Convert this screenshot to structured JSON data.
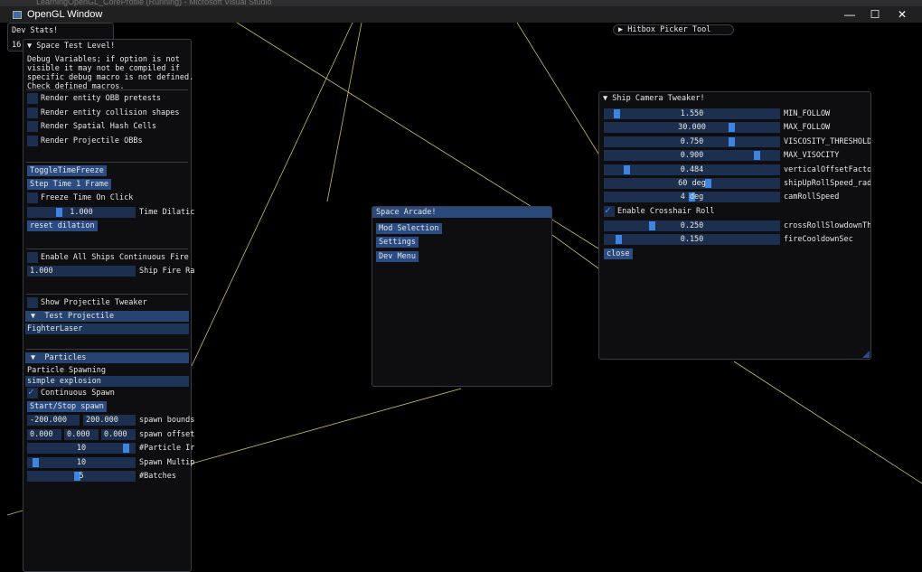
{
  "vs_title": "LearningOpenGL_CoreProfile (Running) - Microsoft Visual Studio",
  "window_title": "OpenGL Window",
  "window_controls": {
    "minimize": "—",
    "maximize": "☐",
    "close": "✕"
  },
  "dev_stats": {
    "title": "Dev Stats!",
    "value": "16."
  },
  "hitbox_picker": {
    "title": "Hitbox Picker Tool"
  },
  "space_test": {
    "title": "Space Test Level!",
    "note": [
      "Debug Variables; if option is not",
      "visible it may not be compiled if",
      "specific debug macro is not defined.",
      "Check defined macros."
    ],
    "render_options": [
      {
        "label": "Render entity OBB pretests",
        "checked": false
      },
      {
        "label": "Render entity collision shapes",
        "checked": false
      },
      {
        "label": "Render Spatial Hash Cells",
        "checked": false
      },
      {
        "label": "Render Projectile OBBs",
        "checked": false
      }
    ],
    "toggle_time_freeze": "ToggleTimeFreeze",
    "step_time": "Step Time 1 Frame",
    "freeze_on_click": "Freeze Time On Click",
    "time_dilation": {
      "value": "1.000",
      "label": "Time Dilatic",
      "fraction": 0.27
    },
    "reset_dilation": "reset dilation",
    "continuous_fire": "Enable All Ships Continuous Fire",
    "ship_fire_rate": {
      "value": "1.000",
      "label": "Ship Fire Ra"
    },
    "show_projectile_tweaker": "Show Projectile Tweaker",
    "test_projectile_header": "Test Projectile",
    "projectile_selected": "FighterLaser",
    "particles_header": "Particles",
    "particle_spawning_label": "Particle Spawning",
    "particle_selected": "simple explosion",
    "continuous_spawn": "Continuous Spawn",
    "start_stop_spawn": "Start/Stop spawn",
    "spawn_bounds": {
      "values": [
        "-200.000",
        "200.000"
      ],
      "label": "spawn bounds"
    },
    "spawn_offset": {
      "values": [
        "0.000",
        "0.000",
        "0.000"
      ],
      "label": "spawn offset"
    },
    "particle_interval": {
      "value": "10",
      "label": "#Particle Ir",
      "fraction": 0.95
    },
    "spawn_multiplier": {
      "value": "10",
      "label": "Spawn Multip",
      "fraction": 0.04
    },
    "batches": {
      "value": "5",
      "label": "#Batches",
      "fraction": 0.46
    }
  },
  "space_arcade": {
    "title": "Space Arcade!",
    "buttons": [
      "Mod Selection",
      "Settings",
      "Dev Menu"
    ]
  },
  "camera_tweaker": {
    "title": "Ship Camera Tweaker!",
    "sliders": [
      {
        "value": "1.550",
        "label": "MIN_FOLLOW",
        "fraction": 0.05
      },
      {
        "value": "30.000",
        "label": "MAX_FOLLOW",
        "fraction": 0.74
      },
      {
        "value": "0.750",
        "label": "VISCOSITY_THRESHOLD",
        "fraction": 0.74
      },
      {
        "value": "0.900",
        "label": "MAX_VISOCITY",
        "fraction": 0.89
      },
      {
        "value": "0.484",
        "label": "verticalOffsetFactor",
        "fraction": 0.11
      },
      {
        "value": "60 deg",
        "label": "shipUpRollSpeed_rad",
        "fraction": 0.6
      },
      {
        "value": "4 deg",
        "label": "camRollSpeed",
        "fraction": 0.5
      }
    ],
    "crosshair_roll": {
      "label": "Enable Crosshair Roll",
      "checked": true
    },
    "sliders2": [
      {
        "value": "0.250",
        "label": "crossRollSlowdownThre",
        "fraction": 0.26
      },
      {
        "value": "0.150",
        "label": "fireCooldownSec",
        "fraction": 0.06
      }
    ],
    "close": "close"
  },
  "colors": {
    "accent": "#3d85e0",
    "frame": "#1d2f4e",
    "button": "#2a4c82",
    "line": "#c8c060"
  }
}
